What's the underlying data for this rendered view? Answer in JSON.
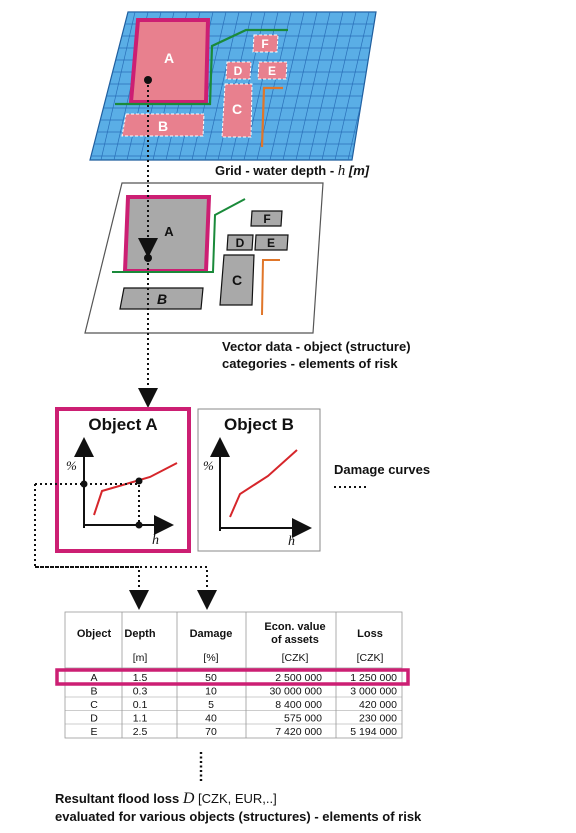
{
  "grid_layer": {
    "objects": {
      "a": "A",
      "b": "B",
      "c": "C",
      "d": "D",
      "e": "E",
      "f": "F"
    },
    "caption_prefix": "Grid -  water depth - ",
    "caption_var": "h",
    "caption_unit": "[m]"
  },
  "vector_layer": {
    "objects": {
      "a": "A",
      "b": "B",
      "c": "C",
      "d": "D",
      "e": "E",
      "f": "F"
    },
    "caption_line1": "Vector data - object (structure)",
    "caption_line2": "categories - elements of risk"
  },
  "damage_curves": {
    "panel_a_title": "Object A",
    "panel_b_title": "Object B",
    "y_axis": "%",
    "x_axis": "h",
    "label": "Damage curves"
  },
  "table": {
    "headers": {
      "object": "Object",
      "depth": "Depth",
      "damage": "Damage",
      "econ_line1": "Econ. value",
      "econ_line2": "of assets",
      "loss": "Loss"
    },
    "units": {
      "depth": "[m]",
      "damage": "[%]",
      "econ": "[CZK]",
      "loss": "[CZK]"
    },
    "rows": [
      {
        "object": "A",
        "depth": "1.5",
        "damage": "50",
        "value": "2 500 000",
        "loss": "1 250 000"
      },
      {
        "object": "B",
        "depth": "0.3",
        "damage": "10",
        "value": "30 000 000",
        "loss": "3 000 000"
      },
      {
        "object": "C",
        "depth": "0.1",
        "damage": "5",
        "value": "8 400 000",
        "loss": "420 000"
      },
      {
        "object": "D",
        "depth": "1.1",
        "damage": "40",
        "value": "575 000",
        "loss": "230 000"
      },
      {
        "object": "E",
        "depth": "2.5",
        "damage": "70",
        "value": "7 420 000",
        "loss": "5 194 000"
      }
    ]
  },
  "result": {
    "line1_prefix": "Resultant flood loss ",
    "line1_var": "D",
    "line1_suffix": " [CZK, EUR,..]",
    "line2": "evaluated for various objects (structures) - elements of risk"
  },
  "colors": {
    "water": "#5aaee6",
    "grid_line": "#2a6fb8",
    "object_pink": "#e8808e",
    "highlight_magenta": "#cc1f73",
    "object_grey": "#a9a9a9",
    "green_line": "#1a8a3a",
    "orange_line": "#e0762a",
    "curve_red": "#d6262b"
  }
}
